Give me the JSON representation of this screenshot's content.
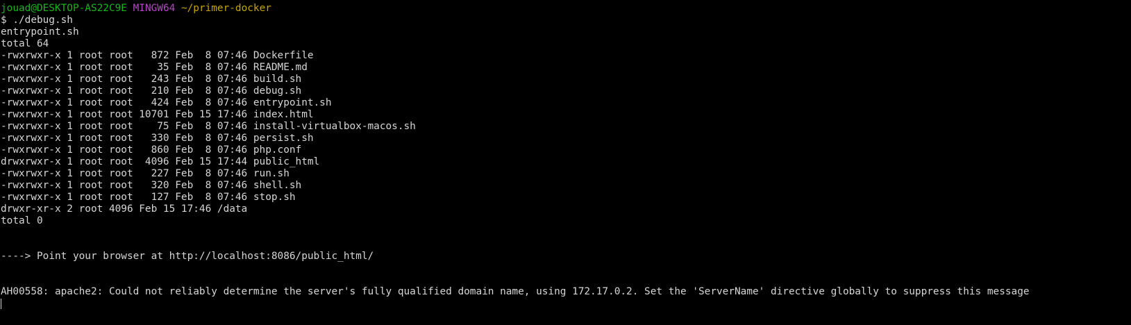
{
  "prompt": {
    "user_host": "jouad@DESKTOP-AS22C9E",
    "msystem": "MINGW64",
    "cwd": "~/primer-docker"
  },
  "command": "$ ./debug.sh",
  "output": {
    "entry": "entrypoint.sh",
    "total1": "total 64",
    "listing": [
      "-rwxrwxr-x 1 root root   872 Feb  8 07:46 Dockerfile",
      "-rwxrwxr-x 1 root root    35 Feb  8 07:46 README.md",
      "-rwxrwxr-x 1 root root   243 Feb  8 07:46 build.sh",
      "-rwxrwxr-x 1 root root   210 Feb  8 07:46 debug.sh",
      "-rwxrwxr-x 1 root root   424 Feb  8 07:46 entrypoint.sh",
      "-rwxrwxr-x 1 root root 10701 Feb 15 17:46 index.html",
      "-rwxrwxr-x 1 root root    75 Feb  8 07:46 install-virtualbox-macos.sh",
      "-rwxrwxr-x 1 root root   330 Feb  8 07:46 persist.sh",
      "-rwxrwxr-x 1 root root   860 Feb  8 07:46 php.conf",
      "drwxrwxr-x 1 root root  4096 Feb 15 17:44 public_html",
      "-rwxrwxr-x 1 root root   227 Feb  8 07:46 run.sh",
      "-rwxrwxr-x 1 root root   320 Feb  8 07:46 shell.sh",
      "-rwxrwxr-x 1 root root   127 Feb  8 07:46 stop.sh"
    ],
    "data_dir": "drwxr-xr-x 2 root 4096 Feb 15 17:46 /data",
    "total2": "total 0",
    "browser_hint": "----> Point your browser at http://localhost:8086/public_html/",
    "apache_warning": "AH00558: apache2: Could not reliably determine the server's fully qualified domain name, using 172.17.0.2. Set the 'ServerName' directive globally to suppress this message"
  },
  "colors": {
    "background": "#000000",
    "text": "#d6d6d6",
    "user_host": "#19b41b",
    "msystem": "#b548c6",
    "cwd": "#c7a400"
  }
}
